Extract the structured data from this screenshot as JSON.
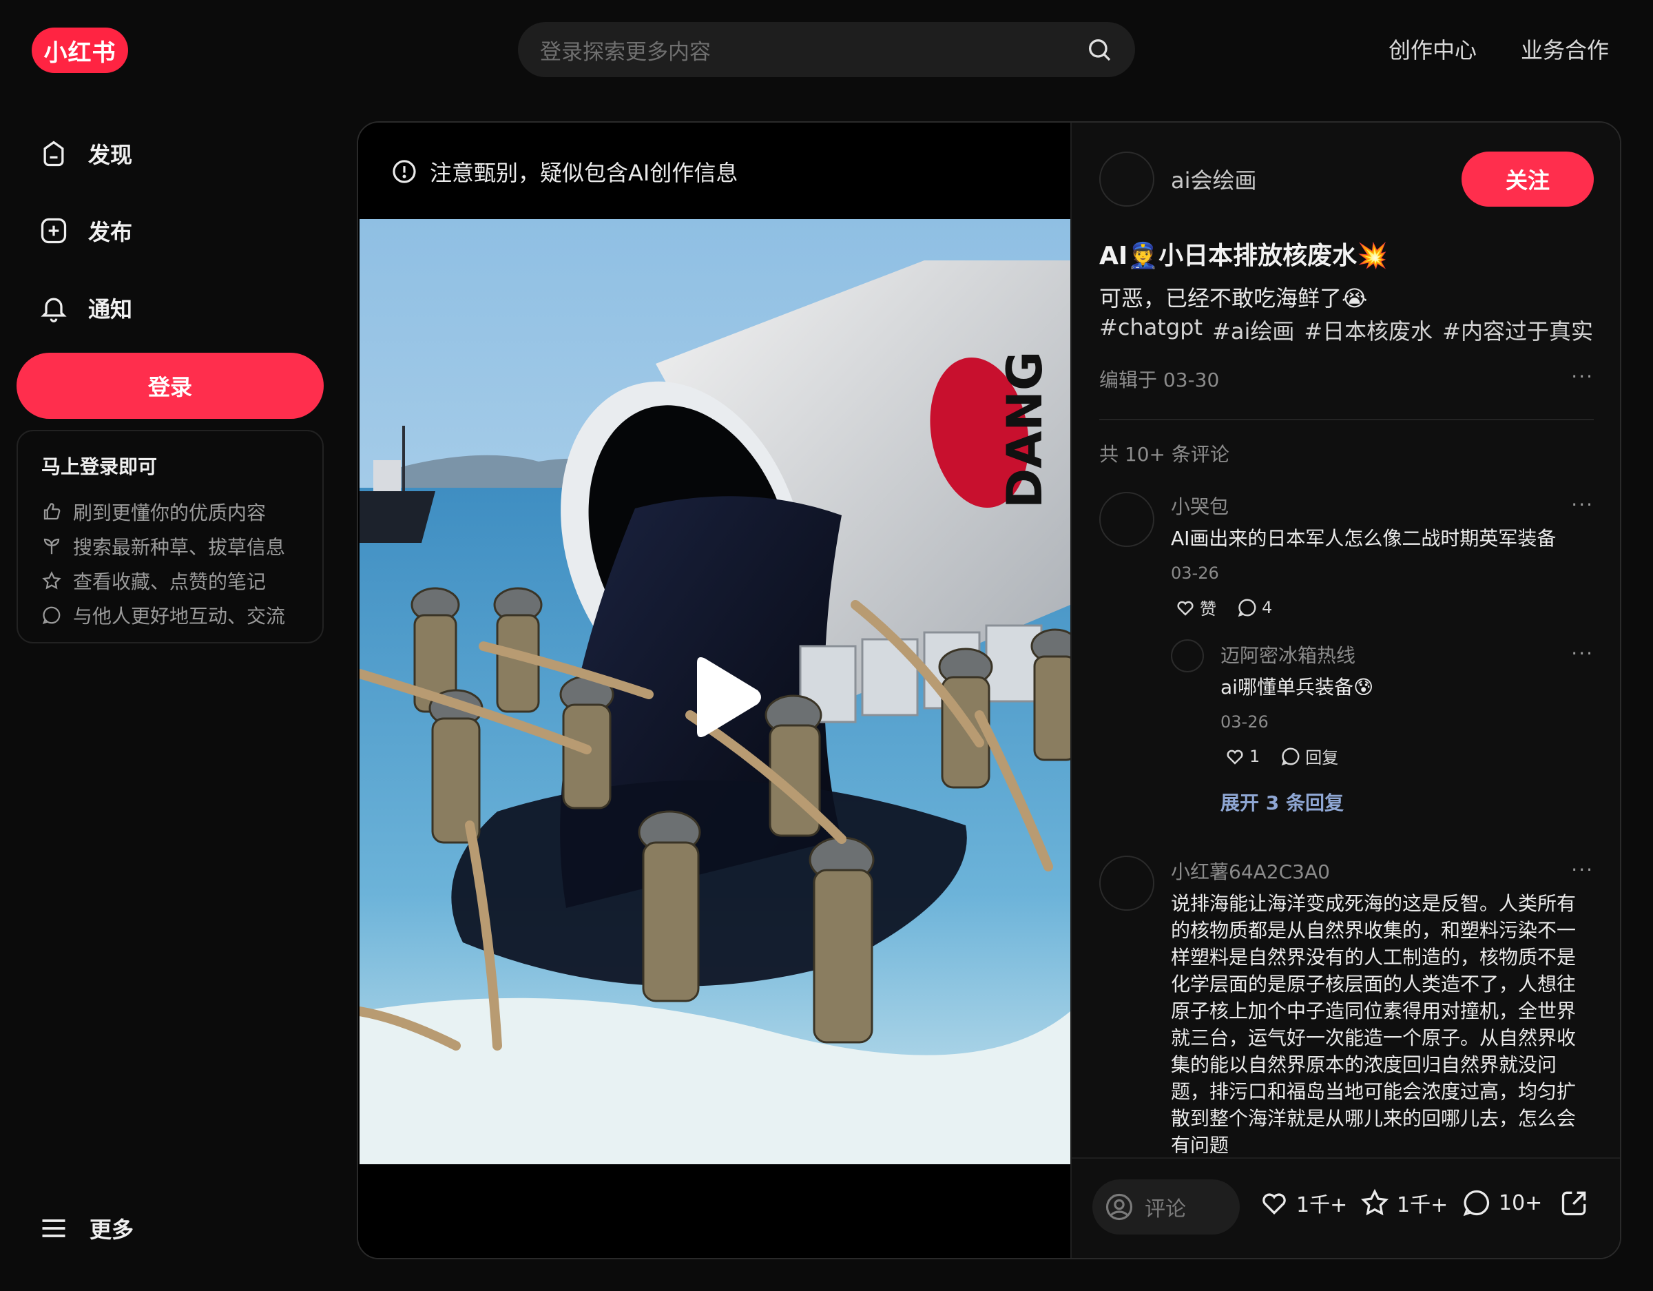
{
  "header": {
    "logo": "小红书",
    "search_placeholder": "登录探索更多内容",
    "nav": [
      "创作中心",
      "业务合作"
    ]
  },
  "sidebar": {
    "items": [
      {
        "label": "发现",
        "icon": "home-icon"
      },
      {
        "label": "发布",
        "icon": "plus-square-icon"
      },
      {
        "label": "通知",
        "icon": "bell-icon"
      }
    ],
    "login_label": "登录",
    "login_card": {
      "title": "马上登录即可",
      "benefits": [
        {
          "text": "刷到更懂你的优质内容",
          "icon": "thumb-up-icon"
        },
        {
          "text": "搜索最新种草、拔草信息",
          "icon": "sprout-icon"
        },
        {
          "text": "查看收藏、点赞的笔记",
          "icon": "star-icon"
        },
        {
          "text": "与他人更好地互动、交流",
          "icon": "chat-icon"
        }
      ]
    },
    "more_label": "更多"
  },
  "media": {
    "ai_notice": "注意甄别，疑似包含AI创作信息"
  },
  "note": {
    "author": "ai会绘画",
    "follow_label": "关注",
    "title": "AI👮小日本排放核废水💥",
    "desc": "可恶，已经不敢吃海鲜了😭",
    "tags": [
      "#chatgpt",
      "#ai绘画",
      "#日本核废水",
      "#内容过于真实"
    ],
    "edited": "编辑于 03-30",
    "comment_count": "共 10+ 条评论"
  },
  "comments": [
    {
      "name": "小哭包",
      "text": "AI画出来的日本军人怎么像二战时期英军装备",
      "date": "03-26",
      "like": "赞",
      "reply": "4",
      "replies": [
        {
          "name": "迈阿密冰箱热线",
          "text": "ai哪懂单兵装备😰",
          "date": "03-26",
          "like": "1",
          "reply": "回复"
        }
      ],
      "expand": "展开 3 条回复"
    },
    {
      "name": "小红薯64A2C3A0",
      "text": "说排海能让海洋变成死海的这是反智。人类所有的核物质都是从自然界收集的，和塑料污染不一样塑料是自然界没有的人工制造的，核物质不是化学层面的是原子核层面的人类造不了，人想往原子核上加个中子造同位素得用对撞机，全世界就三台，运气好一次能造一个原子。从自然界收集的能以自然界原本的浓度回归自然界就没问题，排污口和福岛当地可能会浓度过高，均匀扩散到整个海洋就是从哪儿来的回哪儿去，怎么会有问题"
    }
  ],
  "bottom": {
    "comment_placeholder": "评论",
    "likes": "1千+",
    "collects": "1千+",
    "comments": "10+"
  },
  "colors": {
    "accent": "#ff2442",
    "bg": "#0b0b0b"
  }
}
